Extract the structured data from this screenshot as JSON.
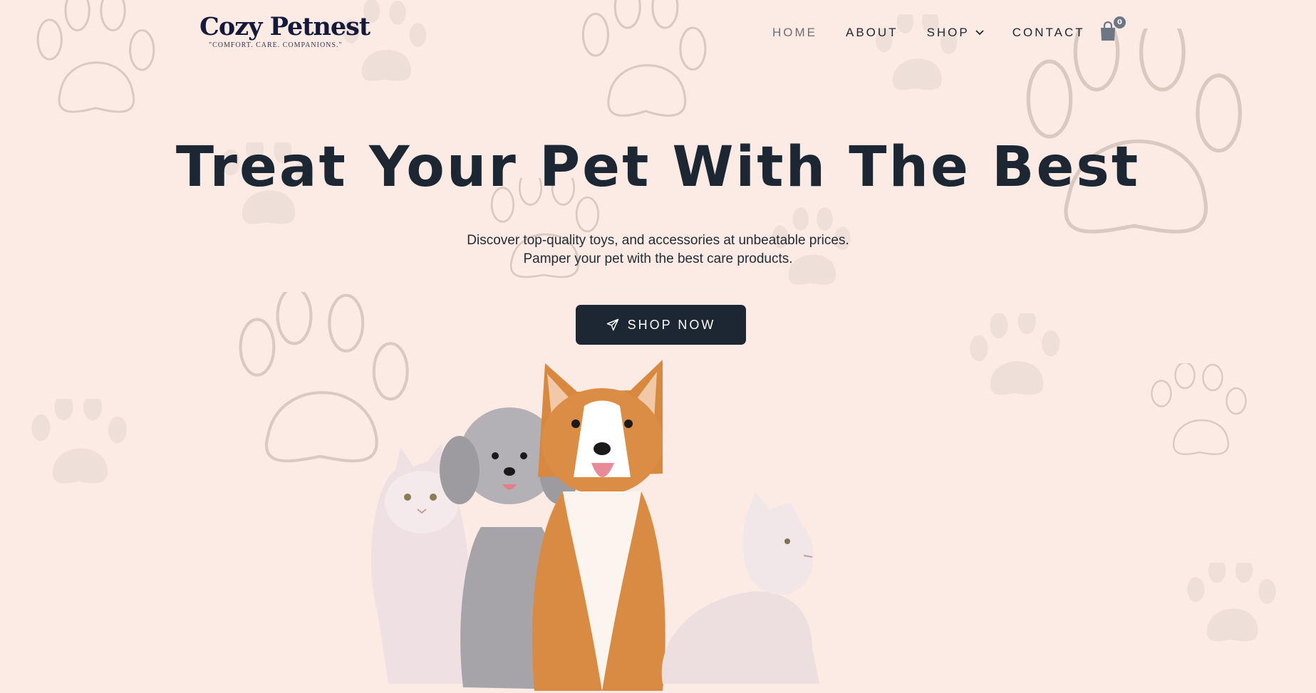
{
  "brand": {
    "name": "Cozy Petnest",
    "tagline": "\"COMFORT. CARE. COMPANIONS.\""
  },
  "nav": {
    "items": [
      {
        "label": "HOME"
      },
      {
        "label": "ABOUT"
      },
      {
        "label": "SHOP"
      },
      {
        "label": "CONTACT"
      }
    ],
    "cart_count": "0"
  },
  "hero": {
    "title": "Treat Your Pet With The Best",
    "subtitle_line1": "Discover top-quality toys, and accessories at unbeatable prices.",
    "subtitle_line2": "Pamper your pet with the best care products.",
    "cta_label": "SHOP NOW"
  },
  "icons": [
    "paw-print-icon",
    "chevron-down-icon",
    "shopping-bag-icon",
    "paper-plane-icon"
  ],
  "colors": {
    "background": "#fcebe4",
    "primary_dark": "#1c2733",
    "logo_navy": "#161a3a",
    "badge_gray": "#6f7683",
    "paw_fill": "#eedfd8"
  }
}
